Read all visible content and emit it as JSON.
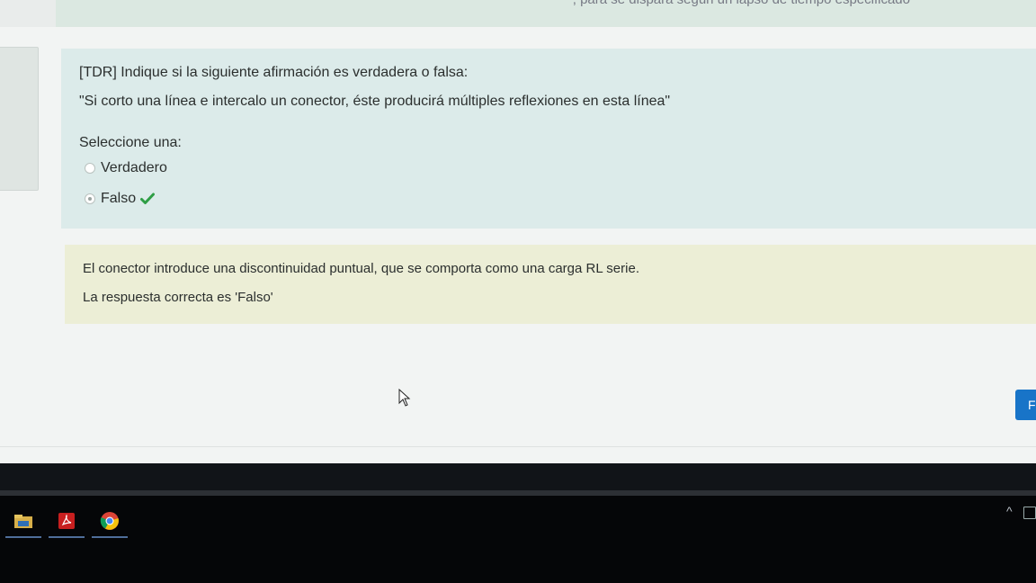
{
  "top": {
    "cut_text": "; para se dispara según un lapso de tiempo especificado"
  },
  "question": {
    "prefix": "[TDR] Indique si la siguiente afirmación es verdadera o falsa:",
    "statement": "\"Si corto una línea e intercalo un conector, éste producirá múltiples reflexiones en esta línea\"",
    "prompt": "Seleccione una:",
    "options": [
      {
        "label": "Verdadero",
        "selected": false
      },
      {
        "label": "Falso",
        "selected": true,
        "correct_icon": "check-icon"
      }
    ]
  },
  "feedback": {
    "general": "El conector introduce una discontinuidad puntual, que se comporta como una carga RL serie.",
    "right_answer": "La respuesta correcta es 'Falso'"
  },
  "navigation": {
    "next_label": "F"
  },
  "taskbar": {
    "apps": [
      {
        "icon": "file-explorer-icon"
      },
      {
        "icon": "acrobat-icon"
      },
      {
        "icon": "chrome-icon"
      }
    ]
  },
  "colors": {
    "question_bg": "#dcebea",
    "feedback_bg": "#eceed6",
    "check_green": "#2e9e45",
    "next_button": "#1874c8"
  }
}
